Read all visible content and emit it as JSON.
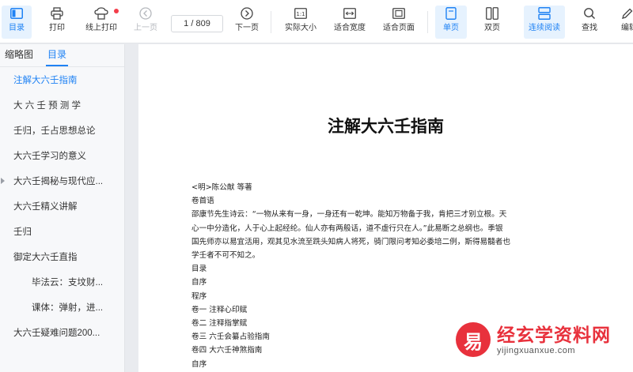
{
  "toolbar": {
    "contents": "目录",
    "print": "打印",
    "online_print": "线上打印",
    "prev_page": "上一页",
    "page_indicator": "1 / 809",
    "next_page": "下一页",
    "actual_size": "实际大小",
    "fit_width": "适合宽度",
    "fit_page": "适合页面",
    "single_page": "单页",
    "double_page": "双页",
    "continuous": "连续阅读",
    "search": "查找",
    "edit": "编辑"
  },
  "sidebar": {
    "tabs": [
      "缩略图",
      "目录"
    ],
    "active_tab": "目录",
    "items": [
      {
        "label": "注解大六壬指南",
        "level": 1,
        "selected": true
      },
      {
        "label": "大 六 壬 预 测 学",
        "level": 1
      },
      {
        "label": "壬归，壬占思想总论",
        "level": 1
      },
      {
        "label": "大六壬学习的意义",
        "level": 1
      },
      {
        "label": "大六壬揭秘与现代应...",
        "level": 1,
        "collapsed": true
      },
      {
        "label": "大六壬精义讲解",
        "level": 1
      },
      {
        "label": "壬归",
        "level": 1
      },
      {
        "label": "御定大六壬直指",
        "level": 1,
        "expanded": true
      },
      {
        "label": "毕法云：支坟财...",
        "level": 2
      },
      {
        "label": "课体：弹射，进...",
        "level": 2
      },
      {
        "label": "大六壬疑难问题200...",
        "level": 1
      }
    ]
  },
  "document": {
    "title": "注解大六壬指南",
    "author": "<明>陈公献 等著",
    "lines": [
      "卷首语",
      "邵康节先生诗云：“一物从来有一身，一身还有一乾坤。能知万物备于我，肯把三才别立根。天",
      "心一中分造化，人于心上起经纶。仙人亦有两般话，道不虚行只在人。”此易断之总纲也。季银",
      "国先师亦以易宜活用，观其见水流至跣头知病人将死，骑门限问考知必委培二例，斯得易髓者也",
      "学壬者不可不知之。",
      "目录",
      "自序",
      "程序",
      "卷一  注释心印赋",
      "卷二  注释指掌赋",
      "卷三  六壬会纂占验指南",
      "卷四  大六壬神煞指南",
      "自序"
    ]
  },
  "watermark": {
    "logo_char": "易",
    "name": "经玄学资料网",
    "url": "yijingxuanxue.com"
  },
  "colors": {
    "accent": "#1f82f4",
    "active_bg": "#e6f2fe",
    "watermark_red": "#e8313c",
    "notification": "#f33d4a"
  }
}
